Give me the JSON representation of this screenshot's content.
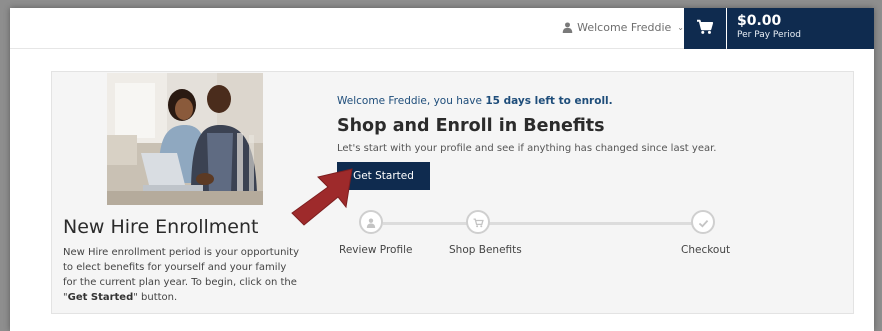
{
  "header": {
    "welcome_text": "Welcome Freddie",
    "cart_amount": "$0.00",
    "cart_period": "Per Pay Period"
  },
  "enrollment": {
    "welcome_prefix": "Welcome Freddie, you have ",
    "days_left": "15 days left to enroll.",
    "heading": "Shop and Enroll in Benefits",
    "subtext": "Let's start with your profile and see if anything has changed since last year.",
    "button_label": "Get Started"
  },
  "left_panel": {
    "title": "New Hire Enrollment",
    "desc_part1": "New Hire enrollment period is your opportunity to elect benefits for yourself and your family for the current plan year. To begin, click on the \"",
    "desc_bold": "Get Started",
    "desc_part2": "\" button."
  },
  "steps": [
    {
      "label": "Review Profile",
      "icon": "user-icon"
    },
    {
      "label": "Shop Benefits",
      "icon": "cart-icon"
    },
    {
      "label": "Checkout",
      "icon": "check-icon"
    }
  ],
  "colors": {
    "navy": "#0f2b4f",
    "link_blue": "#1e4d7a",
    "arrow_red": "#9e2a2b"
  }
}
